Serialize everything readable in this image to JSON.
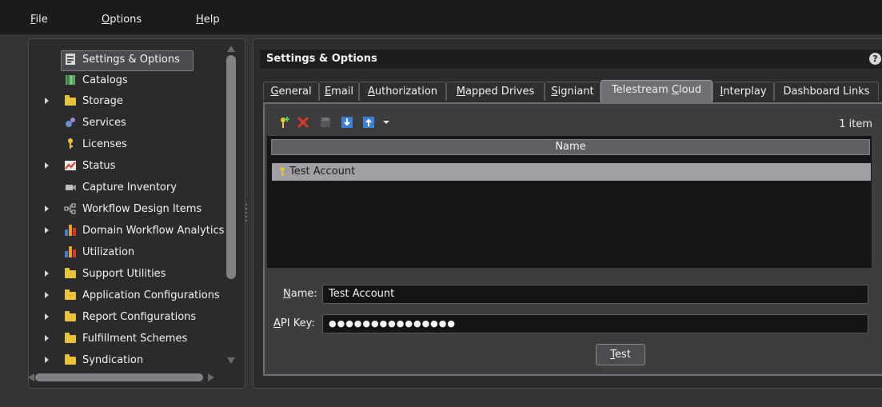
{
  "menu": [
    {
      "label": "File",
      "accel": "F",
      "rest": "ile"
    },
    {
      "label": "Options",
      "accel": "O",
      "rest": "ptions"
    },
    {
      "label": "Help",
      "accel": "H",
      "rest": "elp"
    }
  ],
  "tree": [
    {
      "label": "Settings & Options",
      "icon": "settings-icon",
      "expandable": false,
      "selected": true
    },
    {
      "label": "Catalogs",
      "icon": "catalog-icon",
      "expandable": false
    },
    {
      "label": "Storage",
      "icon": "folder-icon",
      "expandable": true
    },
    {
      "label": "Services",
      "icon": "services-icon",
      "expandable": false
    },
    {
      "label": "Licenses",
      "icon": "key-icon",
      "expandable": false
    },
    {
      "label": "Status",
      "icon": "status-chart-icon",
      "expandable": true
    },
    {
      "label": "Capture Inventory",
      "icon": "camera-icon",
      "expandable": false
    },
    {
      "label": "Workflow Design Items",
      "icon": "workflow-icon",
      "expandable": true
    },
    {
      "label": "Domain Workflow Analytics",
      "icon": "bar-chart-icon",
      "expandable": true
    },
    {
      "label": "Utilization",
      "icon": "bar-chart-icon",
      "expandable": false
    },
    {
      "label": "Support Utilities",
      "icon": "folder-icon",
      "expandable": true
    },
    {
      "label": "Application Configurations",
      "icon": "folder-icon",
      "expandable": true
    },
    {
      "label": "Report Configurations",
      "icon": "folder-icon",
      "expandable": true
    },
    {
      "label": "Fulfillment Schemes",
      "icon": "folder-icon",
      "expandable": true
    },
    {
      "label": "Syndication",
      "icon": "folder-icon",
      "expandable": true
    }
  ],
  "panel_title": "Settings & Options",
  "help_label": "?",
  "tabs": [
    {
      "label": "General",
      "accel": "G",
      "rest": "eneral"
    },
    {
      "label": "Email",
      "accel": "E",
      "rest": "mail"
    },
    {
      "label": "Authorization",
      "accel": "A",
      "rest": "uthorization"
    },
    {
      "label": "Mapped Drives",
      "accel": "M",
      "rest": "apped Drives"
    },
    {
      "label": "Signiant",
      "accel": "S",
      "rest": "igniant"
    },
    {
      "label": "Telestream Cloud",
      "pre": "Telestream ",
      "accel": "C",
      "rest": "loud",
      "active": true
    },
    {
      "label": "Interplay",
      "accel": "I",
      "rest": "nterplay"
    },
    {
      "label": "Dashboard Links",
      "accel": "",
      "rest": "Dashboard Links"
    }
  ],
  "toolbar": {
    "icons": [
      "add-key-icon",
      "delete-icon",
      "save-icon",
      "import-icon",
      "export-icon",
      "dropdown-arrow-icon"
    ],
    "item_count": "1 item"
  },
  "list": {
    "column_header": "Name",
    "rows": [
      {
        "name": "Test Account",
        "icon": "key-icon",
        "selected": true
      }
    ]
  },
  "form": {
    "name_label_accel": "N",
    "name_label_rest": "ame:",
    "name_value": "Test Account",
    "api_key_label_accel": "A",
    "api_key_label_rest": "PI Key:",
    "api_key_value": "●●●●●●●●●●●●●●●",
    "test_button_accel": "T",
    "test_button_rest": "est"
  },
  "colors": {
    "background": "#333436",
    "menubar": "#1b1b1d",
    "selected_row": "#9fa0a3",
    "active_tab": "#6e6f72",
    "folder": "#e9c43b",
    "delete_red": "#d93a2b",
    "blue_icon": "#3c7fd8"
  }
}
